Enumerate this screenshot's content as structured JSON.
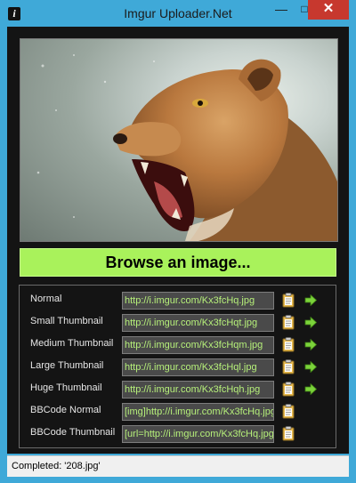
{
  "window": {
    "title": "Imgur Uploader.Net",
    "icon_letter": "i",
    "controls": {
      "minimize": "—",
      "maximize": "□",
      "close": "✕"
    }
  },
  "image_preview": {
    "icon": "lioness-photo"
  },
  "browse_button": {
    "label": "Browse an image..."
  },
  "links": [
    {
      "label": "Normal",
      "value": "http://i.imgur.com/Kx3fcHq.jpg",
      "has_open": true
    },
    {
      "label": "Small Thumbnail",
      "value": "http://i.imgur.com/Kx3fcHqt.jpg",
      "has_open": true
    },
    {
      "label": "Medium Thumbnail",
      "value": "http://i.imgur.com/Kx3fcHqm.jpg",
      "has_open": true
    },
    {
      "label": "Large Thumbnail",
      "value": "http://i.imgur.com/Kx3fcHql.jpg",
      "has_open": true
    },
    {
      "label": "Huge Thumbnail",
      "value": "http://i.imgur.com/Kx3fcHqh.jpg",
      "has_open": true
    },
    {
      "label": "BBCode Normal",
      "value": "[img]http://i.imgur.com/Kx3fcHq.jpg",
      "has_open": false
    },
    {
      "label": "BBCode Thumbnail",
      "value": "[url=http://i.imgur.com/Kx3fcHq.jpg",
      "has_open": false
    }
  ],
  "status": {
    "text": "Completed: '208.jpg'"
  },
  "colors": {
    "frame": "#3fa9d8",
    "client_bg": "#141414",
    "browse_bg": "#a9f25b",
    "link_text": "#b6f07a",
    "close_bg": "#c7382e"
  }
}
